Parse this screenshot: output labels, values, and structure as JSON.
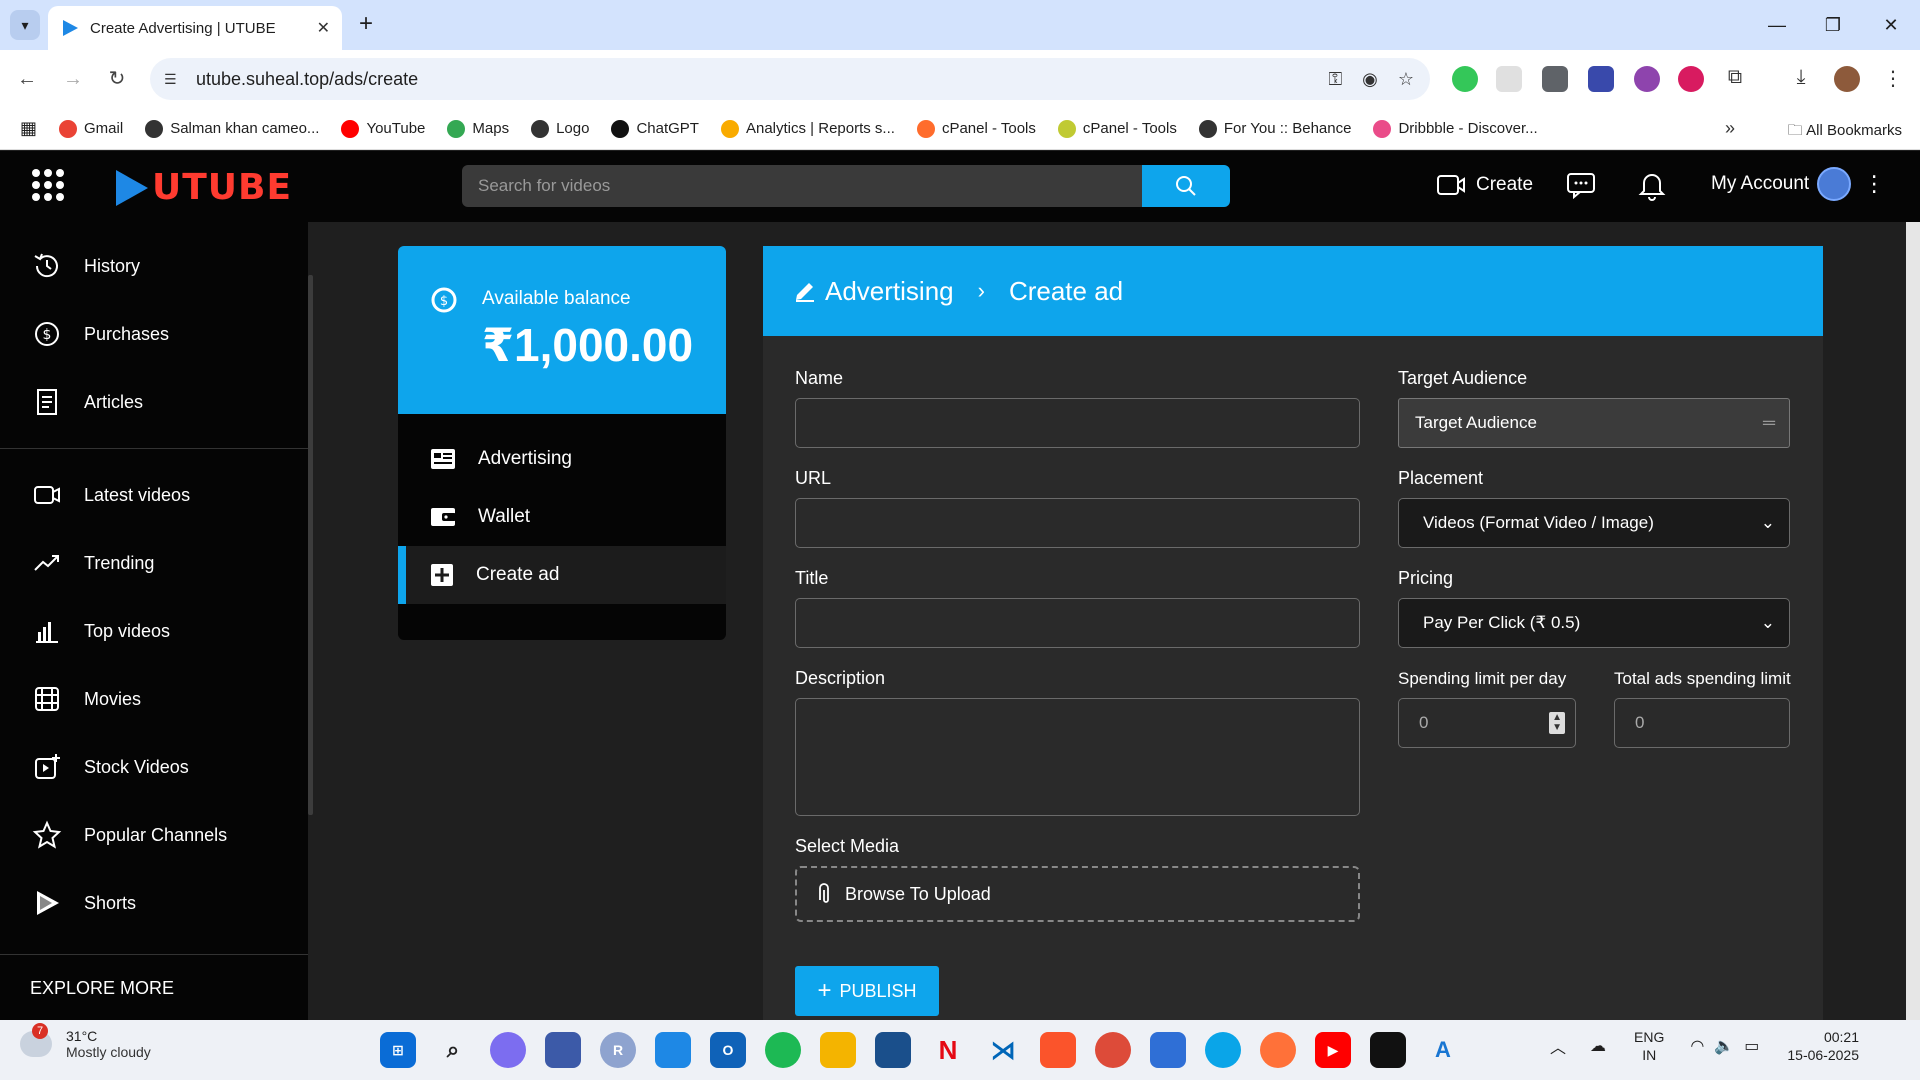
{
  "browser": {
    "tab_title": "Create Advertising | UTUBE",
    "url": "utube.suheal.top/ads/create",
    "bookmarks": [
      {
        "label": "Gmail",
        "color": "#ea4335"
      },
      {
        "label": "Salman khan cameo...",
        "color": "#333333"
      },
      {
        "label": "YouTube",
        "color": "#ff0000"
      },
      {
        "label": "Maps",
        "color": "#34a853"
      },
      {
        "label": "Logo",
        "color": "#333333"
      },
      {
        "label": "ChatGPT",
        "color": "#111111"
      },
      {
        "label": "Analytics | Reports s...",
        "color": "#f9ab00"
      },
      {
        "label": "cPanel - Tools",
        "color": "#ff6c2c"
      },
      {
        "label": "cPanel - Tools",
        "color": "#c0ca33"
      },
      {
        "label": "For You :: Behance",
        "color": "#333333"
      },
      {
        "label": "Dribbble - Discover...",
        "color": "#ea4c89"
      }
    ],
    "all_bookmarks": "All Bookmarks"
  },
  "header": {
    "logo": "UTUBE",
    "search_placeholder": "Search for videos",
    "create_label": "Create",
    "account_label": "My Account"
  },
  "sidebar": {
    "group1": [
      {
        "label": "History",
        "icon": "history-icon"
      },
      {
        "label": "Purchases",
        "icon": "dollar-icon"
      },
      {
        "label": "Articles",
        "icon": "articles-icon"
      }
    ],
    "group2": [
      {
        "label": "Latest videos",
        "icon": "video-icon"
      },
      {
        "label": "Trending",
        "icon": "trending-icon"
      },
      {
        "label": "Top videos",
        "icon": "bar-chart-icon"
      },
      {
        "label": "Movies",
        "icon": "film-icon"
      },
      {
        "label": "Stock Videos",
        "icon": "stock-video-icon"
      },
      {
        "label": "Popular Channels",
        "icon": "star-icon"
      },
      {
        "label": "Shorts",
        "icon": "shorts-icon"
      }
    ],
    "explore": "EXPLORE MORE"
  },
  "balance": {
    "label": "Available balance",
    "value": "₹1,000.00"
  },
  "ad_menu": [
    {
      "label": "Advertising",
      "icon": "advertising-icon",
      "active": false
    },
    {
      "label": "Wallet",
      "icon": "wallet-icon",
      "active": false
    },
    {
      "label": "Create ad",
      "icon": "plus-square-icon",
      "active": true
    }
  ],
  "form": {
    "breadcrumb_root": "Advertising",
    "breadcrumb_current": "Create ad",
    "name_label": "Name",
    "url_label": "URL",
    "title_label": "Title",
    "description_label": "Description",
    "media_label": "Select Media",
    "media_button": "Browse To Upload",
    "audience_label": "Target Audience",
    "audience_value": "Target Audience",
    "placement_label": "Placement",
    "placement_value": "Videos (Format Video / Image)",
    "pricing_label": "Pricing",
    "pricing_value": "Pay Per Click (₹ 0.5)",
    "daily_limit_label": "Spending limit per day",
    "daily_limit_value": "0",
    "total_limit_label": "Total ads spending limit",
    "total_limit_value": "0",
    "publish_label": "PUBLISH"
  },
  "taskbar": {
    "weather_badge": "7",
    "temperature": "31°C",
    "condition": "Mostly cloudy",
    "lang1": "ENG",
    "lang2": "IN",
    "time": "00:21",
    "date": "15-06-2025"
  },
  "colors": {
    "accent": "#0ea5ec",
    "logo_red": "#ff3b30",
    "panel_dark": "#050505",
    "page_bg": "#1f1f1f"
  }
}
